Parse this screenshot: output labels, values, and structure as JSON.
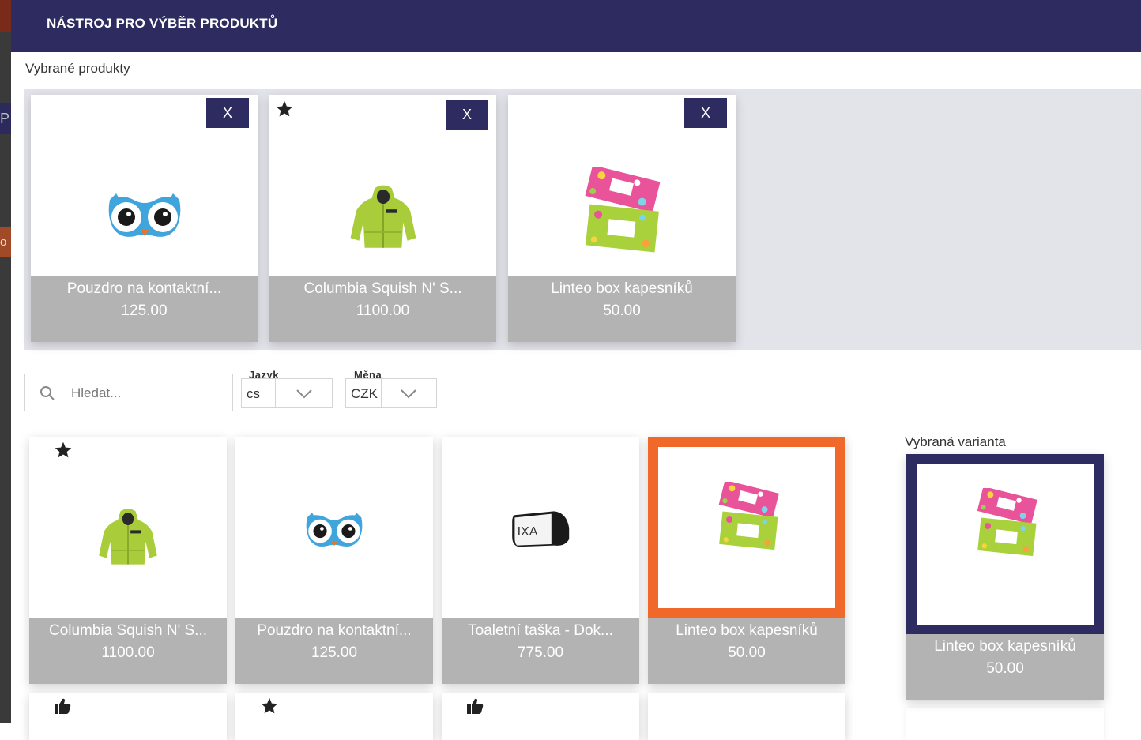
{
  "header": {
    "title": "NÁSTROJ PRO VÝBĚR PRODUKTŮ"
  },
  "selected": {
    "label": "Vybrané produkty",
    "remove_label": "X",
    "items": [
      {
        "name": "Pouzdro na kontaktní...",
        "price": "125.00",
        "image": "owl-lens-case"
      },
      {
        "name": "Columbia Squish N' S...",
        "price": "1100.00",
        "image": "green-jacket",
        "starred": true
      },
      {
        "name": "Linteo box kapesníků",
        "price": "50.00",
        "image": "tissue-box"
      }
    ]
  },
  "filters": {
    "search_placeholder": "Hledat...",
    "language_label": "Jazyk",
    "language_value": "cs",
    "currency_label": "Měna",
    "currency_value": "CZK"
  },
  "products": [
    {
      "name": "Columbia Squish N' S...",
      "price": "1100.00",
      "image": "green-jacket",
      "badge": "star-icon"
    },
    {
      "name": "Pouzdro na kontaktní...",
      "price": "125.00",
      "image": "owl-lens-case"
    },
    {
      "name": "Toaletní taška - Dok...",
      "price": "775.00",
      "image": "toiletry-bag"
    },
    {
      "name": "Linteo box kapesníků",
      "price": "50.00",
      "image": "tissue-box",
      "highlighted": true
    }
  ],
  "next_row_badges": [
    "thumbs-up-icon",
    "star-icon",
    "thumbs-up-icon"
  ],
  "variant": {
    "label": "Vybraná varianta",
    "name": "Linteo box kapesníků",
    "price": "50.00",
    "image": "tissue-box"
  },
  "colors": {
    "header_bg": "#2d2b5f",
    "highlight": "#f0692a",
    "caption_bg": "#b3b3b3",
    "selected_area_bg": "#e3e3ea"
  }
}
